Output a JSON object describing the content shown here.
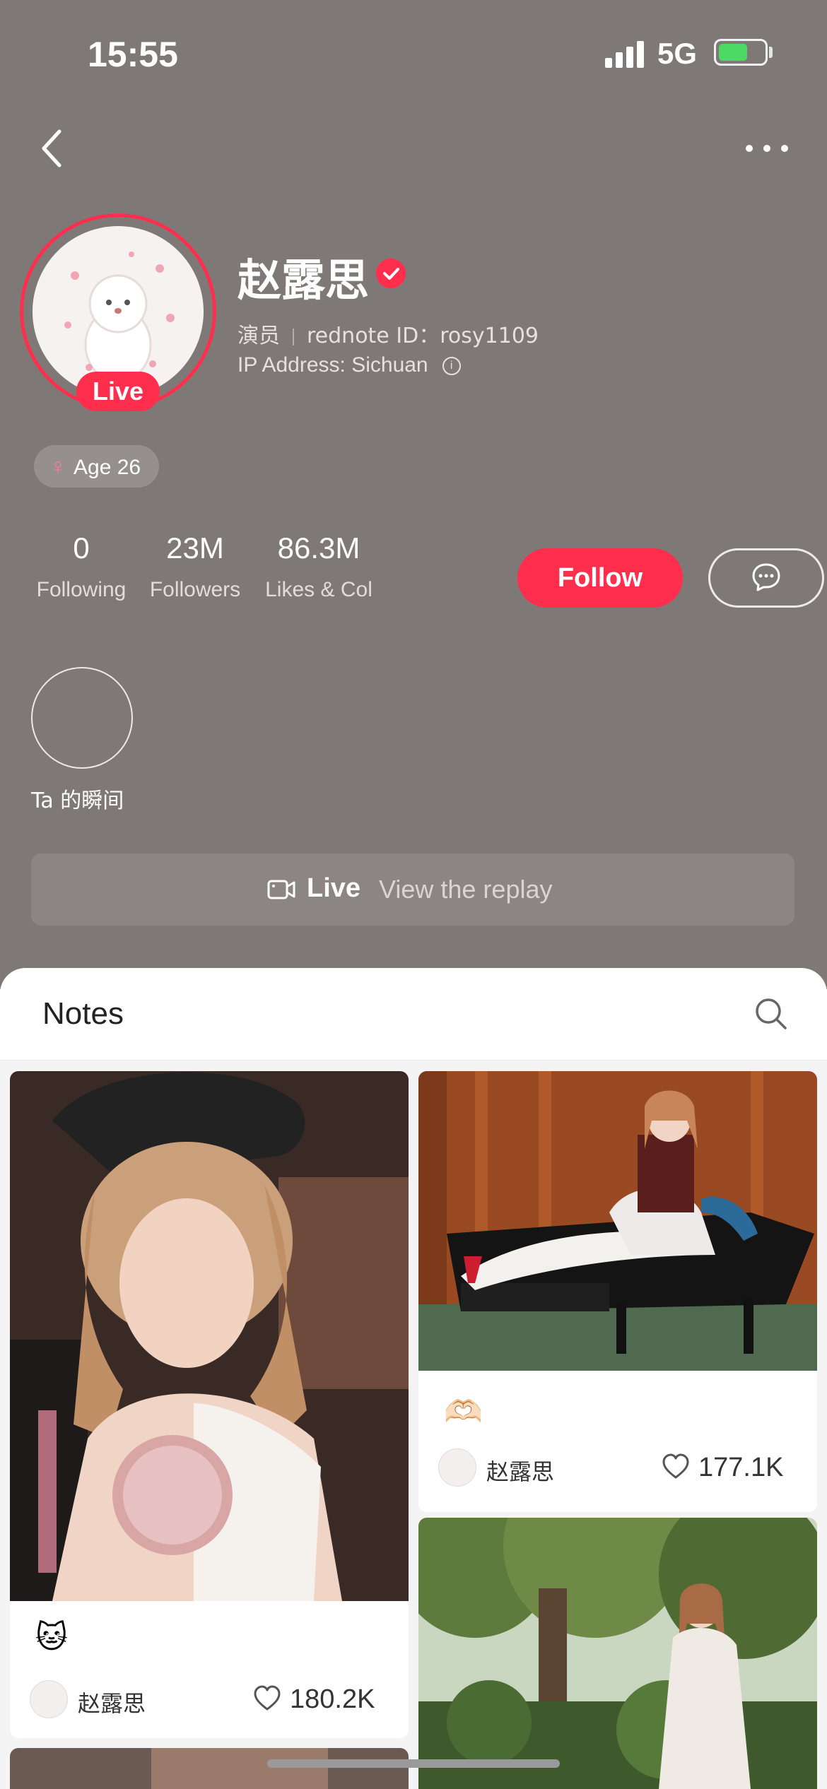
{
  "status_bar": {
    "time": "15:55",
    "network": "5G"
  },
  "profile": {
    "name": "赵露思",
    "occupation": "演员",
    "rednote_id": "rednote ID：rosy1109",
    "ip_address": "IP Address: Sichuan",
    "live_badge": "Live",
    "age": "Age 26"
  },
  "stats": [
    {
      "value": "0",
      "label": "Following"
    },
    {
      "value": "23M",
      "label": "Followers"
    },
    {
      "value": "86.3M",
      "label": "Likes & Col"
    }
  ],
  "actions": {
    "follow_label": "Follow"
  },
  "moments": {
    "label": "Ta 的瞬间"
  },
  "live_bar": {
    "live_label": "Live",
    "replay_label": "View the replay"
  },
  "notes": {
    "title": "Notes",
    "cards": [
      {
        "caption": "🐱",
        "author": "赵露思",
        "likes": "180.2K"
      },
      {
        "caption": "🫶🏻",
        "author": "赵露思",
        "likes": "177.1K"
      }
    ]
  },
  "colors": {
    "accent": "#ff2e4d",
    "header_bg": "#7e7877"
  }
}
